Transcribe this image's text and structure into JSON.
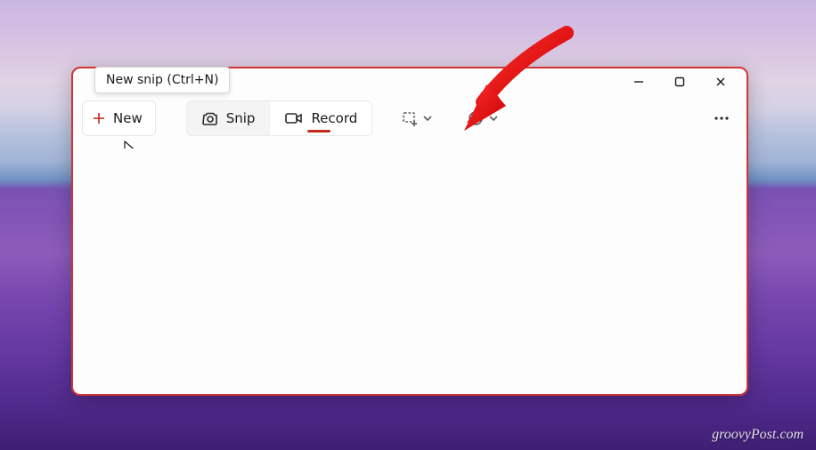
{
  "tooltip": {
    "new_button": "New snip (Ctrl+N)"
  },
  "toolbar": {
    "new_label": "New",
    "snip_label": "Snip",
    "record_label": "Record"
  },
  "window_controls": {
    "minimize_glyph": "—",
    "maximize_glyph": "▢",
    "close_glyph": "✕"
  },
  "watermark": "groovyPost.com"
}
